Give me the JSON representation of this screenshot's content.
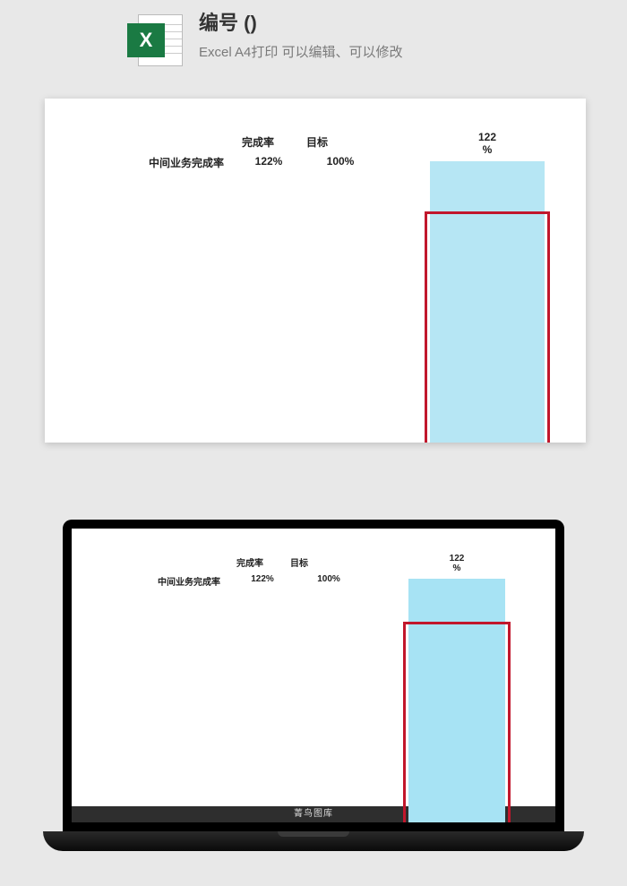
{
  "header": {
    "title": "编号 ()",
    "subtitle": "Excel  A4打印 可以编辑、可以修改",
    "icon_letter": "X"
  },
  "watermark": "菁鸟图库",
  "table": {
    "col1_header": "完成率",
    "col2_header": "目标",
    "row_label": "中间业务完成率",
    "value_completion": "122%",
    "value_target": "100%"
  },
  "bar": {
    "label_value": "122",
    "label_suffix": "%"
  },
  "chart_data": {
    "type": "bar",
    "title": "",
    "categories": [
      "中间业务完成率"
    ],
    "series": [
      {
        "name": "完成率",
        "values": [
          122
        ]
      },
      {
        "name": "目标",
        "values": [
          100
        ]
      }
    ],
    "ylabel": "",
    "ylim": [
      0,
      125
    ],
    "annotations": [
      "122%"
    ]
  }
}
